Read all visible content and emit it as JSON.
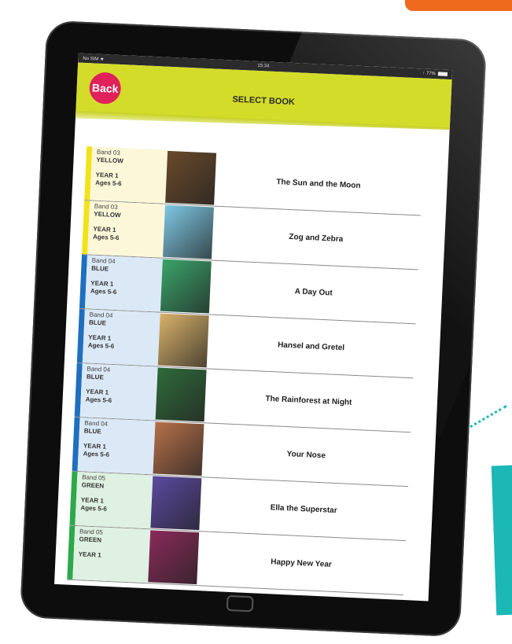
{
  "colors": {
    "accent": "#d4dc2a",
    "back_button": "#e0215a",
    "band_yellow": "#f2e21a",
    "band_blue": "#1f6fbf",
    "band_green": "#2da84a",
    "decor_teal": "#1bb8b5",
    "decor_orange": "#f06a1e"
  },
  "statusbar": {
    "carrier": "No SIM ★",
    "time": "15:34",
    "battery": "↑ 77%"
  },
  "header": {
    "back_label": "Back",
    "title": "SELECT BOOK"
  },
  "books": [
    {
      "band": "Band 03",
      "color": "YELLOW",
      "year": "YEAR 1",
      "ages": "Ages 5-6",
      "title": "The Sun and the Moon",
      "stripe": "#f2e21a",
      "bg": "#fbf7d8",
      "cover": "#6a4a2a"
    },
    {
      "band": "Band 03",
      "color": "YELLOW",
      "year": "YEAR 1",
      "ages": "Ages 5-6",
      "title": "Zog and Zebra",
      "stripe": "#f2e21a",
      "bg": "#fbf7d8",
      "cover": "#7ec8e3"
    },
    {
      "band": "Band 04",
      "color": "BLUE",
      "year": "YEAR 1",
      "ages": "Ages 5-6",
      "title": "A Day Out",
      "stripe": "#1f6fbf",
      "bg": "#dbe9f6",
      "cover": "#3aa46a"
    },
    {
      "band": "Band 04",
      "color": "BLUE",
      "year": "YEAR 1",
      "ages": "Ages 5-6",
      "title": "Hansel and Gretel",
      "stripe": "#1f6fbf",
      "bg": "#dbe9f6",
      "cover": "#d9b26a"
    },
    {
      "band": "Band 04",
      "color": "BLUE",
      "year": "YEAR 1",
      "ages": "Ages 5-6",
      "title": "The Rainforest at Night",
      "stripe": "#1f6fbf",
      "bg": "#dbe9f6",
      "cover": "#2f6b3a"
    },
    {
      "band": "Band 04",
      "color": "BLUE",
      "year": "YEAR 1",
      "ages": "Ages 5-6",
      "title": "Your Nose",
      "stripe": "#1f6fbf",
      "bg": "#dbe9f6",
      "cover": "#b5704a"
    },
    {
      "band": "Band 05",
      "color": "GREEN",
      "year": "YEAR 1",
      "ages": "Ages 5-6",
      "title": "Ella the Superstar",
      "stripe": "#2da84a",
      "bg": "#dff1e2",
      "cover": "#5a4aa0"
    },
    {
      "band": "Band 05",
      "color": "GREEN",
      "year": "YEAR 1",
      "ages": "",
      "title": "Happy New Year",
      "stripe": "#2da84a",
      "bg": "#dff1e2",
      "cover": "#8a2a5a"
    }
  ]
}
